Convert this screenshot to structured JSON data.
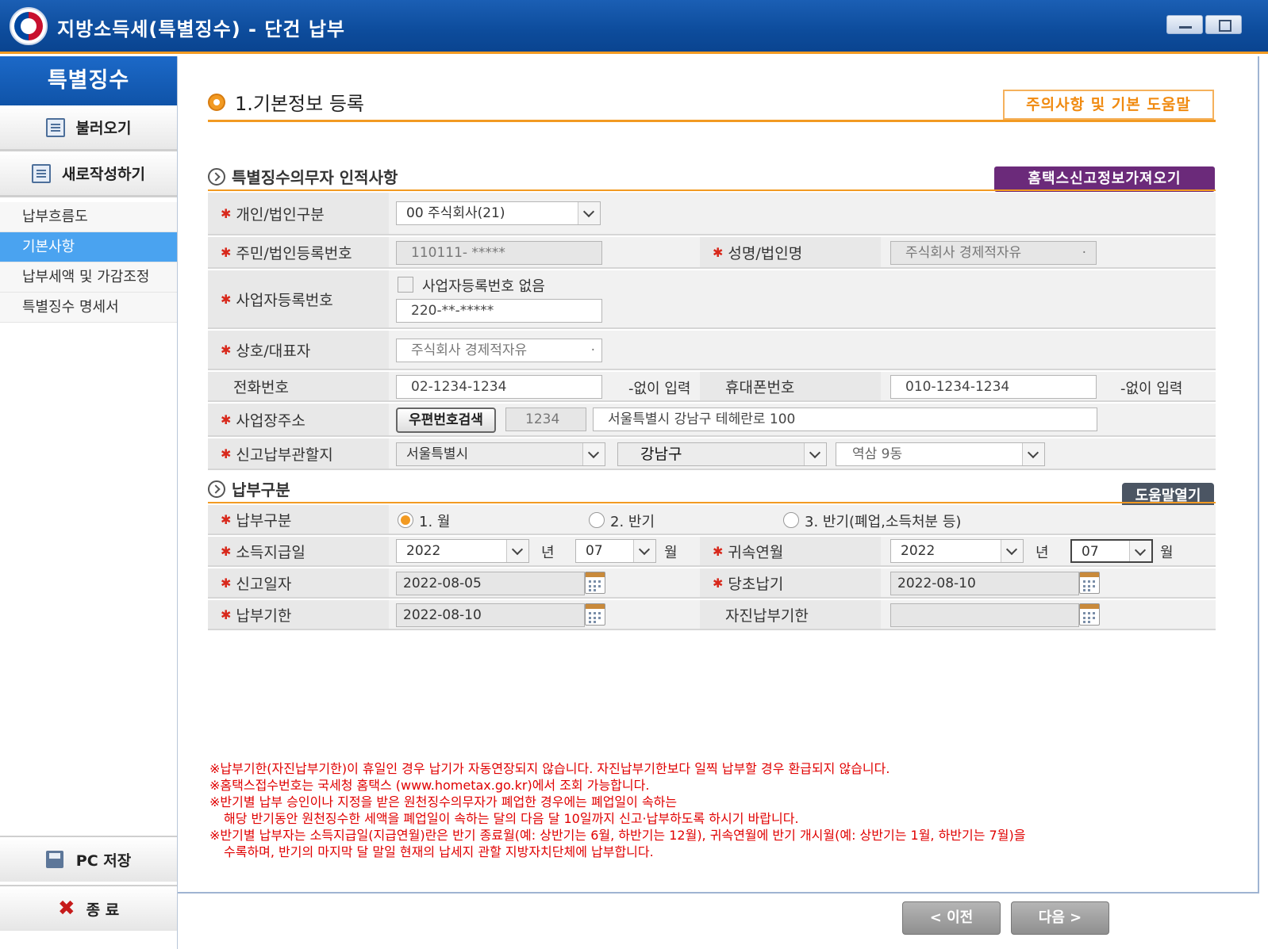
{
  "window": {
    "title": "지방소득세(특별징수) - 단건 납부"
  },
  "sidebar": {
    "header": "특별징수",
    "load_label": "불러오기",
    "new_label": "새로작성하기",
    "items": [
      {
        "label": "납부흐름도"
      },
      {
        "label": "기본사항"
      },
      {
        "label": "납부세액 및 가감조정"
      },
      {
        "label": "특별징수 명세서"
      }
    ],
    "save_label": "PC 저장",
    "exit_label": "종 료"
  },
  "main": {
    "section_title": "1.기본정보 등록",
    "help_button": "주의사항 및 기본 도움말",
    "agent_section": {
      "title": "특별징수의무자 인적사항",
      "hometax_button": "홈택스신고정보가져오기",
      "entity_type_label": "개인/법인구분",
      "entity_type_value": "00 주식회사(21)",
      "reg_no_label": "주민/법인등록번호",
      "reg_no_value": "110111-   *****",
      "name_label": "성명/법인명",
      "name_value": "주식회사 경제적자유",
      "name_value_marker": "·",
      "biz_no_label": "사업자등록번호",
      "biz_no_none_label": "사업자등록번호 없음",
      "biz_no_value": "220-**-*****",
      "company_label": "상호/대표자",
      "company_value": "주식회사 경제적자유",
      "company_value_marker": "·",
      "phone_label": "전화번호",
      "phone_value": "02-1234-1234",
      "phone_hint": "-없이 입력",
      "mobile_label": "휴대폰번호",
      "mobile_value": "010-1234-1234",
      "mobile_hint": "-없이 입력",
      "address_label": "사업장주소",
      "zip_button": "우편번호검색",
      "zip_value": "1234",
      "address_value": "서울특별시 강남구 테헤란로 100",
      "jurisdiction_label": "신고납부관할지",
      "city_value": "서울특별시",
      "district_value": "강남구",
      "dong_value": "역삼 9동"
    },
    "payment_section": {
      "title": "납부구분",
      "help_button": "도움말열기",
      "type_label": "납부구분",
      "options": [
        {
          "label": "1. 월",
          "selected": true
        },
        {
          "label": "2. 반기",
          "selected": false
        },
        {
          "label": "3. 반기(폐업,소득처분 등)",
          "selected": false
        }
      ],
      "pay_date_label": "소득지급일",
      "pay_year": "2022",
      "year_unit": "년",
      "pay_month": "07",
      "month_unit": "월",
      "attr_label": "귀속연월",
      "attr_year": "2022",
      "attr_month": "07",
      "report_date_label": "신고일자",
      "report_date": "2022-08-05",
      "orig_due_label": "당초납기",
      "orig_due": "2022-08-10",
      "due_label": "납부기한",
      "due_value": "2022-08-10",
      "self_due_label": "자진납부기한",
      "self_due_value": ""
    },
    "notes": [
      "※납부기한(자진납부기한)이 휴일인 경우 납기가 자동연장되지 않습니다. 자진납부기한보다 일찍 납부할 경우 환급되지 않습니다.",
      "※홈택스접수번호는 국세청 홈택스 (www.hometax.go.kr)에서 조회 가능합니다.",
      "※반기별 납부 승인이나 지정을 받은 원천징수의무자가 폐업한 경우에는 폐업일이 속하는",
      "해당 반기동안 원천징수한 세액을 폐업일이 속하는 달의 다음 달 10일까지 신고·납부하도록 하시기 바랍니다.",
      "※반기별 납부자는 소득지급일(지급연월)란은 반기 종료월(예: 상반기는 6월, 하반기는 12월), 귀속연월에 반기 개시월(예: 상반기는 1월, 하반기는 7월)을",
      "수록하며, 반기의 마지막 달 말일 현재의 납세지 관할 지방자치단체에 납부합니다."
    ],
    "prev_button": "< 이전",
    "next_button": "다음 >"
  },
  "colors": {
    "accent_orange": "#f29a22",
    "title_blue": "#0d4c9c",
    "purple_button": "#6b2a7a",
    "required_star": "#d8281b",
    "notes_red": "#e00000"
  }
}
